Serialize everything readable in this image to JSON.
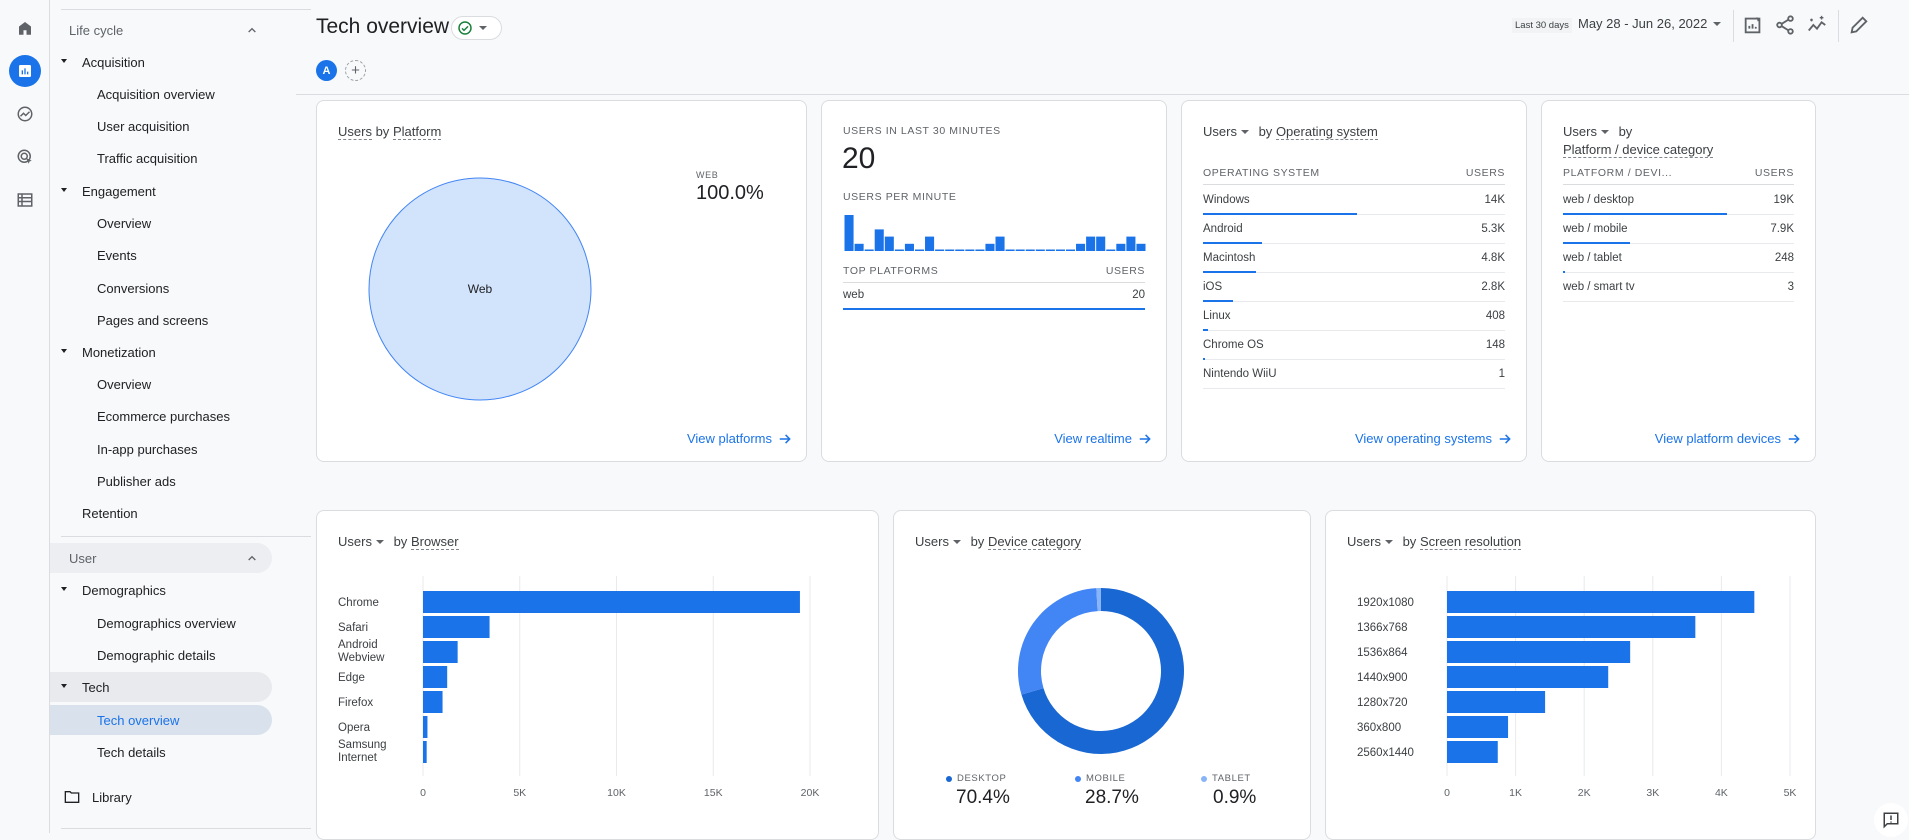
{
  "rail": {
    "icons": [
      {
        "name": "home-icon"
      },
      {
        "name": "reports-icon",
        "active": true
      },
      {
        "name": "explore-icon"
      },
      {
        "name": "advertising-icon"
      },
      {
        "name": "configure-icon"
      }
    ]
  },
  "nav": {
    "lifecycle_label": "Life cycle",
    "acquisition": "Acquisition",
    "acquisition_overview": "Acquisition overview",
    "user_acquisition": "User acquisition",
    "traffic_acquisition": "Traffic acquisition",
    "engagement": "Engagement",
    "engagement_overview": "Overview",
    "events": "Events",
    "conversions": "Conversions",
    "pages_and_screens": "Pages and screens",
    "monetization": "Monetization",
    "monetization_overview": "Overview",
    "ecommerce_purchases": "Ecommerce purchases",
    "inapp_purchases": "In-app purchases",
    "publisher_ads": "Publisher ads",
    "retention": "Retention",
    "user_label": "User",
    "demographics": "Demographics",
    "demographics_overview": "Demographics overview",
    "demographic_details": "Demographic details",
    "tech": "Tech",
    "tech_overview": "Tech overview",
    "tech_details": "Tech details",
    "library": "Library"
  },
  "header": {
    "title": "Tech overview",
    "avatar_letter": "A",
    "date_chip": "Last 30 days",
    "date_range": "May 28 - Jun 26, 2022"
  },
  "colors": {
    "accent": "#1a73e8",
    "desktop": "#1967d2",
    "mobile": "#4285f4",
    "tablet": "#8ab4f8",
    "pie_fill": "#d2e3fc"
  },
  "platform_card": {
    "title_metric": "Users",
    "title_by": "by",
    "title_dim": "Platform",
    "slice_label": "Web",
    "legend_label": "WEB",
    "legend_value": "100.0%",
    "link": "View platforms"
  },
  "realtime_card": {
    "users_label": "USERS IN LAST 30 MINUTES",
    "users_value": "20",
    "per_minute_label": "USERS PER MINUTE",
    "top_platforms_label": "TOP PLATFORMS",
    "users_col": "USERS",
    "rows": [
      {
        "label": "web",
        "value": "20",
        "fraction": 1.0
      }
    ],
    "link": "View realtime"
  },
  "os_card": {
    "title_metric": "Users",
    "title_by": "by",
    "title_dim": "Operating system",
    "col1": "OPERATING SYSTEM",
    "col2": "USERS",
    "rows": [
      {
        "label": "Windows",
        "value": "14K",
        "fraction": 0.51
      },
      {
        "label": "Android",
        "value": "5.3K",
        "fraction": 0.195
      },
      {
        "label": "Macintosh",
        "value": "4.8K",
        "fraction": 0.175
      },
      {
        "label": "iOS",
        "value": "2.8K",
        "fraction": 0.1
      },
      {
        "label": "Linux",
        "value": "408",
        "fraction": 0.015
      },
      {
        "label": "Chrome OS",
        "value": "148",
        "fraction": 0.005
      },
      {
        "label": "Nintendo WiiU",
        "value": "1",
        "fraction": 0
      }
    ],
    "link": "View operating systems"
  },
  "device_cat_card": {
    "title_metric": "Users",
    "title_by": "by",
    "title_dim": "Platform / device category",
    "col1": "PLATFORM / DEVI...",
    "col2": "USERS",
    "rows": [
      {
        "label": "web / desktop",
        "value": "19K",
        "fraction": 0.71
      },
      {
        "label": "web / mobile",
        "value": "7.9K",
        "fraction": 0.29
      },
      {
        "label": "web / tablet",
        "value": "248",
        "fraction": 0.009
      },
      {
        "label": "web / smart tv",
        "value": "3",
        "fraction": 0
      }
    ],
    "link": "View platform devices"
  },
  "browser_card": {
    "title_metric": "Users",
    "title_by": "by",
    "title_dim": "Browser"
  },
  "device_card": {
    "title_metric": "Users",
    "title_by": "by",
    "title_dim": "Device category"
  },
  "resolution_card": {
    "title_metric": "Users",
    "title_by": "by",
    "title_dim": "Screen resolution"
  },
  "chart_data": [
    {
      "id": "platform",
      "type": "pie",
      "title": "Users by Platform",
      "categories": [
        "Web"
      ],
      "values": [
        100.0
      ]
    },
    {
      "id": "per_minute",
      "type": "bar",
      "title": "Users per minute",
      "categories": [
        "1",
        "2",
        "3",
        "4",
        "5",
        "6",
        "7",
        "8",
        "9",
        "10",
        "11",
        "12",
        "13",
        "14",
        "15",
        "16",
        "17",
        "18",
        "19",
        "20",
        "21",
        "22",
        "23",
        "24",
        "25",
        "26",
        "27",
        "28",
        "29",
        "30"
      ],
      "values": [
        5,
        1,
        0,
        3,
        2,
        0,
        1,
        0,
        2,
        0,
        0,
        0,
        0,
        0,
        1,
        2,
        0,
        0,
        0,
        0,
        0,
        0,
        0,
        1,
        2,
        2,
        0,
        1,
        2,
        1
      ],
      "ylim": [
        0,
        5
      ]
    },
    {
      "id": "browser",
      "type": "bar",
      "orientation": "horizontal",
      "title": "Users by Browser",
      "categories": [
        "Chrome",
        "Safari",
        "Android Webview",
        "Edge",
        "Firefox",
        "Opera",
        "Samsung Internet"
      ],
      "values": [
        19480,
        3440,
        1790,
        1250,
        1010,
        230,
        190
      ],
      "xlim": [
        0,
        20000
      ],
      "xticks": [
        "0",
        "5K",
        "10K",
        "15K",
        "20K"
      ],
      "grid": true
    },
    {
      "id": "device",
      "type": "pie",
      "variant": "donut",
      "title": "Users by Device category",
      "categories": [
        "DESKTOP",
        "MOBILE",
        "TABLET"
      ],
      "values": [
        70.4,
        28.7,
        0.9
      ],
      "labels": [
        "70.4%",
        "28.7%",
        "0.9%"
      ],
      "legend": "bottom"
    },
    {
      "id": "resolution",
      "type": "bar",
      "orientation": "horizontal",
      "title": "Users by Screen resolution",
      "categories": [
        "1920x1080",
        "1366x768",
        "1536x864",
        "1440x900",
        "1280x720",
        "360x800",
        "2560x1440"
      ],
      "values": [
        4480,
        3620,
        2670,
        2350,
        1430,
        890,
        740
      ],
      "xlim": [
        0,
        5000
      ],
      "xticks": [
        "0",
        "1K",
        "2K",
        "3K",
        "4K",
        "5K"
      ],
      "grid": true
    }
  ]
}
